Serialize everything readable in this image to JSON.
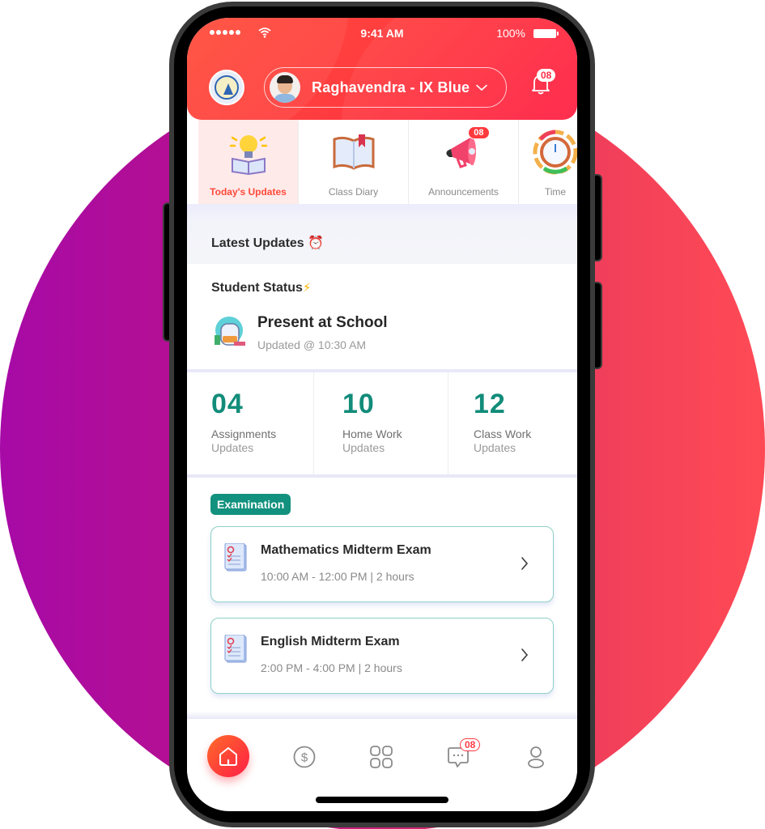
{
  "status_bar": {
    "time": "9:41 AM",
    "battery": "100%"
  },
  "header": {
    "student_selector": "Raghavendra - IX Blue",
    "notification_count": "08"
  },
  "quick_menu": [
    {
      "label": "Today's Updates",
      "icon": "lightbulb-book-icon",
      "active": true
    },
    {
      "label": "Class Diary",
      "icon": "open-book-icon"
    },
    {
      "label": "Announcements",
      "icon": "megaphone-icon",
      "badge": "08"
    },
    {
      "label": "Time",
      "icon": "clock-icon"
    }
  ],
  "latest_updates": {
    "title": "Latest Updates ⏰"
  },
  "student_status": {
    "title": "Student Status",
    "status": "Present at School",
    "updated": "Updated @ 10:30 AM"
  },
  "counts": [
    {
      "value": "04",
      "label": "Assignments",
      "sub": "Updates"
    },
    {
      "value": "10",
      "label": "Home Work",
      "sub": "Updates"
    },
    {
      "value": "12",
      "label": "Class Work",
      "sub": "Updates"
    }
  ],
  "examination": {
    "badge": "Examination",
    "exams": [
      {
        "title": "Mathematics Midterm Exam",
        "time": "10:00 AM - 12:00 PM | 2 hours"
      },
      {
        "title": "English Midterm Exam",
        "time": "2:00 PM - 4:00 PM | 2 hours"
      }
    ]
  },
  "tabbar": {
    "items": [
      "home-icon",
      "dollar-icon",
      "grid-icon",
      "chat-icon",
      "profile-icon"
    ],
    "chat_badge": "08"
  },
  "colors": {
    "brand_red": "#ff2e45",
    "teal": "#12917e",
    "bg_circle_start": "#a70aa6",
    "bg_circle_end": "#ff4a55"
  }
}
